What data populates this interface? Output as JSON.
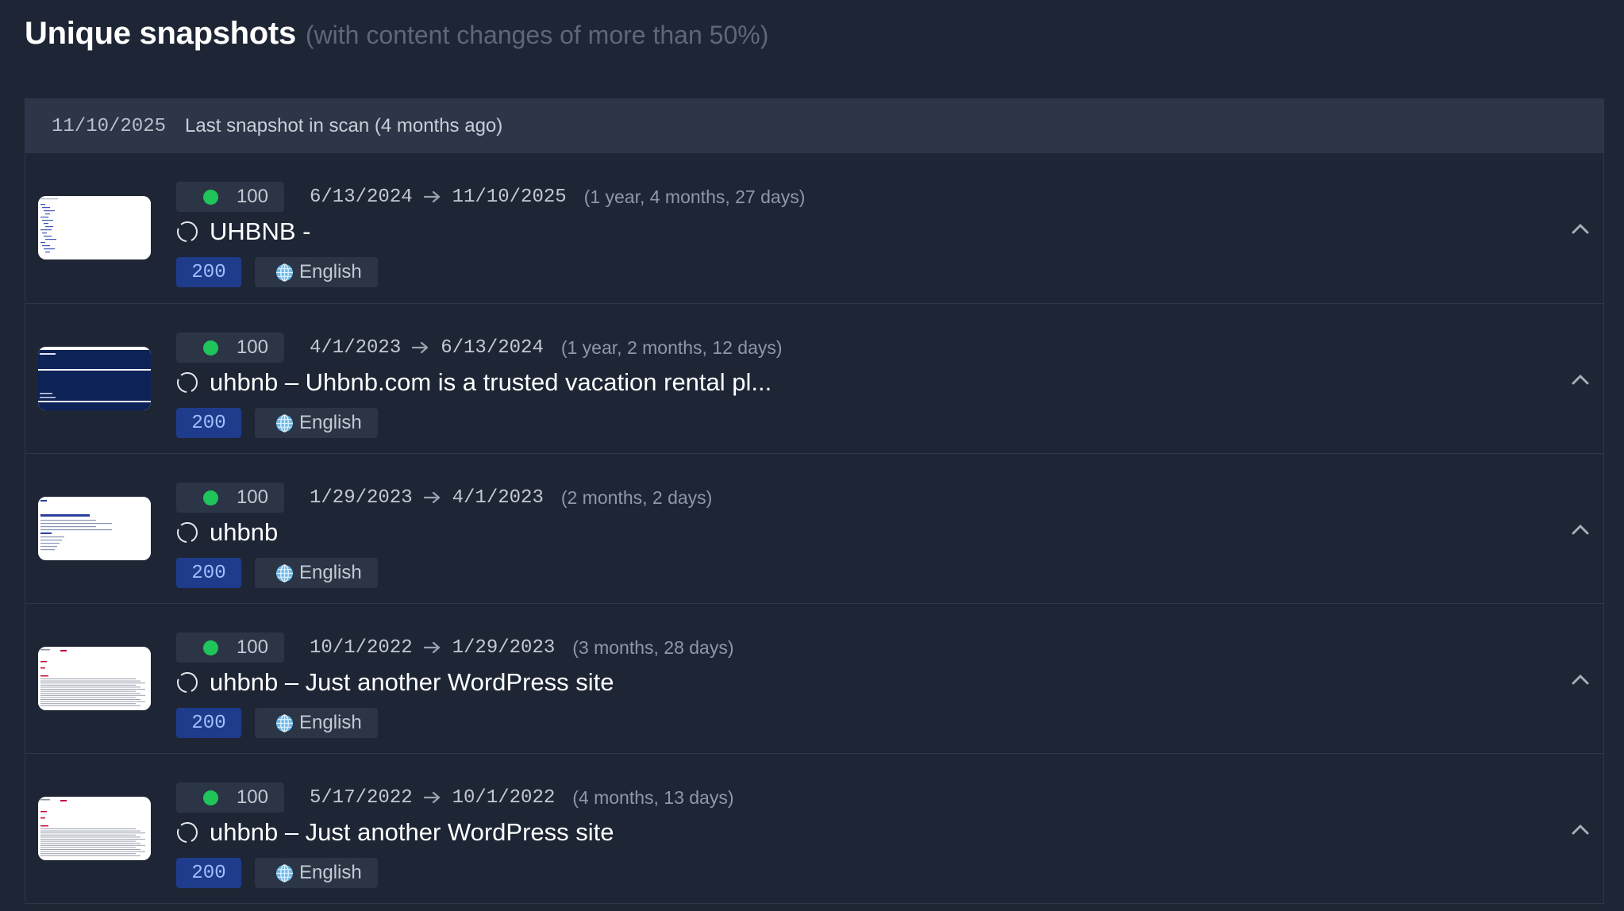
{
  "section": {
    "title": "Unique snapshots",
    "subtitle": "(with content changes of more than 50%)"
  },
  "scan_header": {
    "date": "11/10/2025",
    "label": "Last snapshot in scan (4 months ago)"
  },
  "colors": {
    "score_dot": "#1fc45a",
    "status_badge_bg": "#1f3b8c",
    "status_badge_text": "#9fc0ff",
    "background": "#1e2635",
    "globe": "#6cb8ea"
  },
  "snapshots": [
    {
      "score": "100",
      "date_from": "6/13/2024",
      "date_to": "11/10/2025",
      "duration": "(1 year, 4 months, 27 days)",
      "title": "UHBNB -",
      "status": "200",
      "language": "English",
      "thumbnail": "white-page-with-links"
    },
    {
      "score": "100",
      "date_from": "4/1/2023",
      "date_to": "6/13/2024",
      "duration": "(1 year, 2 months, 12 days)",
      "title": "uhbnb – Uhbnb.com is a trusted vacation rental pl...",
      "status": "200",
      "language": "English",
      "thumbnail": "dark-navy-page"
    },
    {
      "score": "100",
      "date_from": "1/29/2023",
      "date_to": "4/1/2023",
      "duration": "(2 months, 2 days)",
      "title": "uhbnb",
      "status": "200",
      "language": "English",
      "thumbnail": "white-page-with-blue-text"
    },
    {
      "score": "100",
      "date_from": "10/1/2022",
      "date_to": "1/29/2023",
      "duration": "(3 months, 28 days)",
      "title": "uhbnb – Just another WordPress site",
      "status": "200",
      "language": "English",
      "thumbnail": "white-page-wordpress"
    },
    {
      "score": "100",
      "date_from": "5/17/2022",
      "date_to": "10/1/2022",
      "duration": "(4 months, 13 days)",
      "title": "uhbnb – Just another WordPress site",
      "status": "200",
      "language": "English",
      "thumbnail": "white-page-wordpress"
    }
  ]
}
